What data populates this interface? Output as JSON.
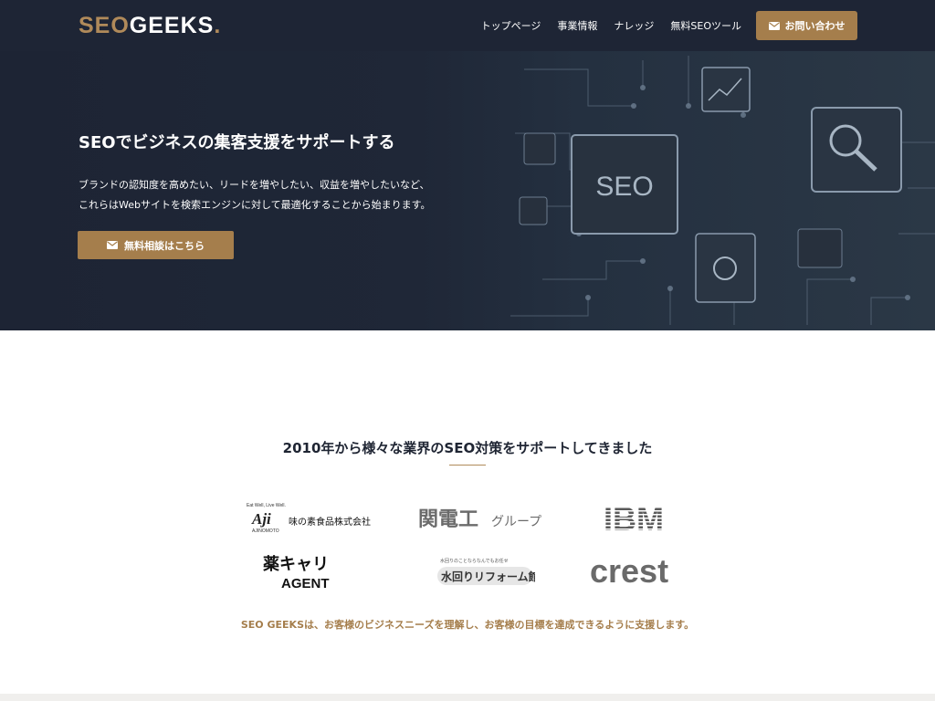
{
  "header": {
    "logo": {
      "seo": "SEO",
      "geeks": "GEEKS",
      "dot": "."
    },
    "nav": [
      "トップページ",
      "事業情報",
      "ナレッジ",
      "無料SEOツール"
    ],
    "contact_label": "お問い合わせ"
  },
  "hero": {
    "title": "SEOでビジネスの集客支援をサポートする",
    "desc_line1": "ブランドの認知度を高めたい、リードを増やしたい、収益を増やしたいなど、",
    "desc_line2": "これらはWebサイトを検索エンジンに対して最適化することから始まります。",
    "cta_label": "無料相談はこちら",
    "art_text": "SEO"
  },
  "clients": {
    "title": "2010年から様々な業界のSEO対策をサポートしてきました",
    "logos": {
      "ajinomoto_tagline": "Eat Well, Live Well.",
      "ajinomoto_mark": "Aji",
      "ajinomoto_sub": "AJINOMOTO",
      "ajinomoto_name": "味の素食品株式会社",
      "kandenko": "関電工",
      "kandenko_group": "グループ",
      "ibm": "IBM",
      "yakucari_top": "薬キャリ",
      "yakucari_bottom": "AGENT",
      "mizumawari_small": "水回りのことならなんでもお任せ",
      "mizumawari": "水回りリフォーム館",
      "crest": "crest"
    },
    "tagline": "SEO GEEKSは、お客様のビジネスニーズを理解し、お客様の目標を達成できるように支援します。"
  },
  "colors": {
    "header_bg": "#1e2535",
    "accent": "#a57e4c",
    "hero_bg": "#1f2737"
  }
}
